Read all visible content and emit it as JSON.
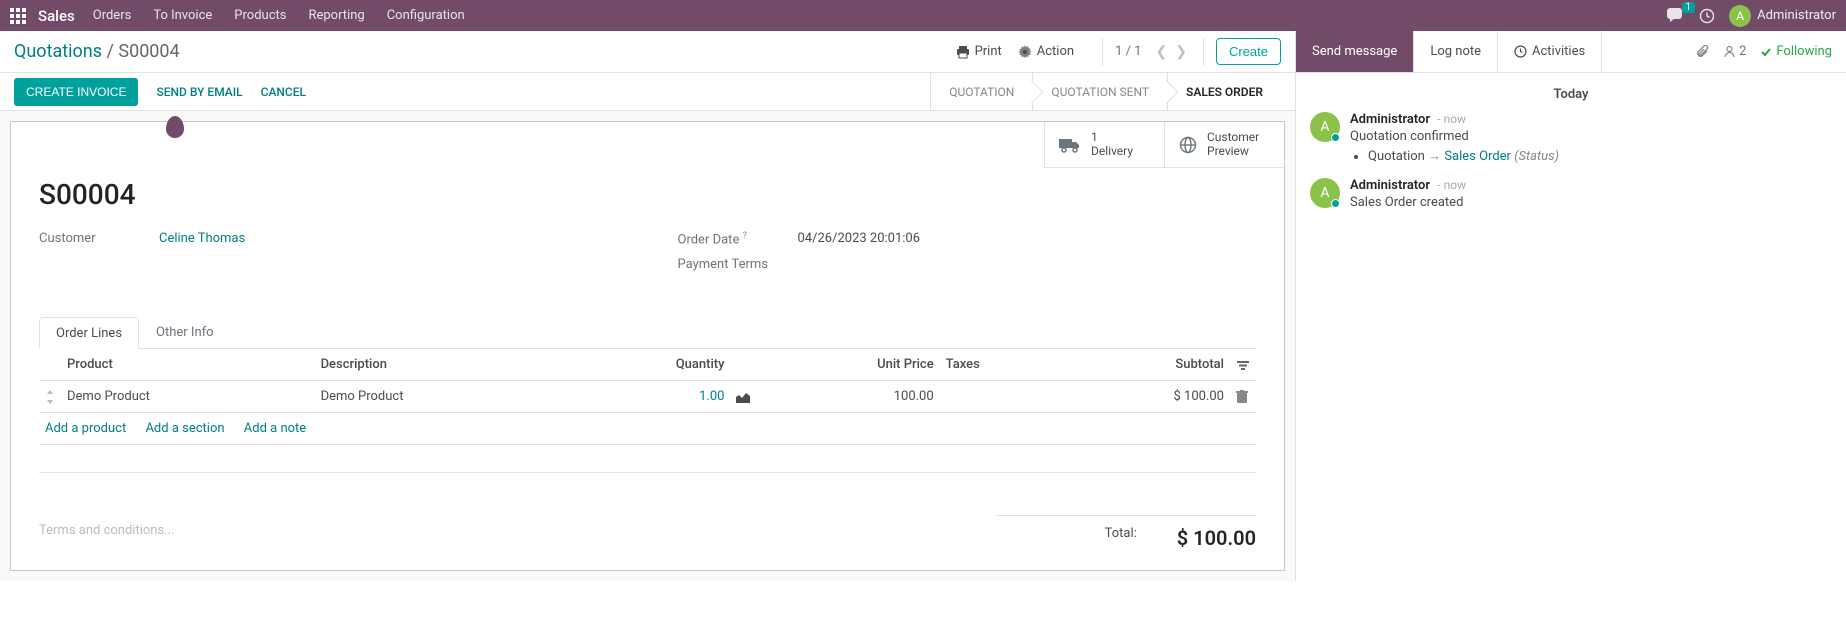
{
  "topnav": {
    "brand": "Sales",
    "menu": [
      "Orders",
      "To Invoice",
      "Products",
      "Reporting",
      "Configuration"
    ],
    "chat_badge": "1",
    "user_initial": "A",
    "user_name": "Administrator"
  },
  "breadcrumb": {
    "root": "Quotations",
    "current": "S00004"
  },
  "controls": {
    "print": "Print",
    "action": "Action",
    "pager": "1 / 1",
    "create": "Create"
  },
  "actions": {
    "create_invoice": "CREATE INVOICE",
    "send_email": "SEND BY EMAIL",
    "cancel": "CANCEL"
  },
  "status_steps": [
    "QUOTATION",
    "QUOTATION SENT",
    "SALES ORDER"
  ],
  "stats": {
    "delivery_count": "1",
    "delivery_label": "Delivery",
    "preview_line1": "Customer",
    "preview_line2": "Preview"
  },
  "order": {
    "name": "S00004",
    "customer_label": "Customer",
    "customer_value": "Celine Thomas",
    "date_label": "Order Date",
    "date_sup": "?",
    "date_value": "04/26/2023 20:01:06",
    "terms_label": "Payment Terms"
  },
  "tabs": [
    "Order Lines",
    "Other Info"
  ],
  "table": {
    "headers": {
      "product": "Product",
      "description": "Description",
      "quantity": "Quantity",
      "unit_price": "Unit Price",
      "taxes": "Taxes",
      "subtotal": "Subtotal"
    },
    "rows": [
      {
        "product": "Demo Product",
        "description": "Demo Product",
        "quantity": "1.00",
        "unit_price": "100.00",
        "taxes": "",
        "subtotal": "$ 100.00"
      }
    ],
    "add_product": "Add a product",
    "add_section": "Add a section",
    "add_note": "Add a note"
  },
  "footer": {
    "terms_placeholder": "Terms and conditions...",
    "total_label": "Total:",
    "total_value": "$ 100.00"
  },
  "chatter": {
    "send": "Send message",
    "log": "Log note",
    "activities": "Activities",
    "followers": "2",
    "following": "Following",
    "day": "Today",
    "messages": [
      {
        "author": "Administrator",
        "time": "now",
        "body": "Quotation confirmed",
        "tracking": {
          "from": "Quotation",
          "to": "Sales Order",
          "field": "(Status)"
        }
      },
      {
        "author": "Administrator",
        "time": "now",
        "body": "Sales Order created"
      }
    ]
  }
}
